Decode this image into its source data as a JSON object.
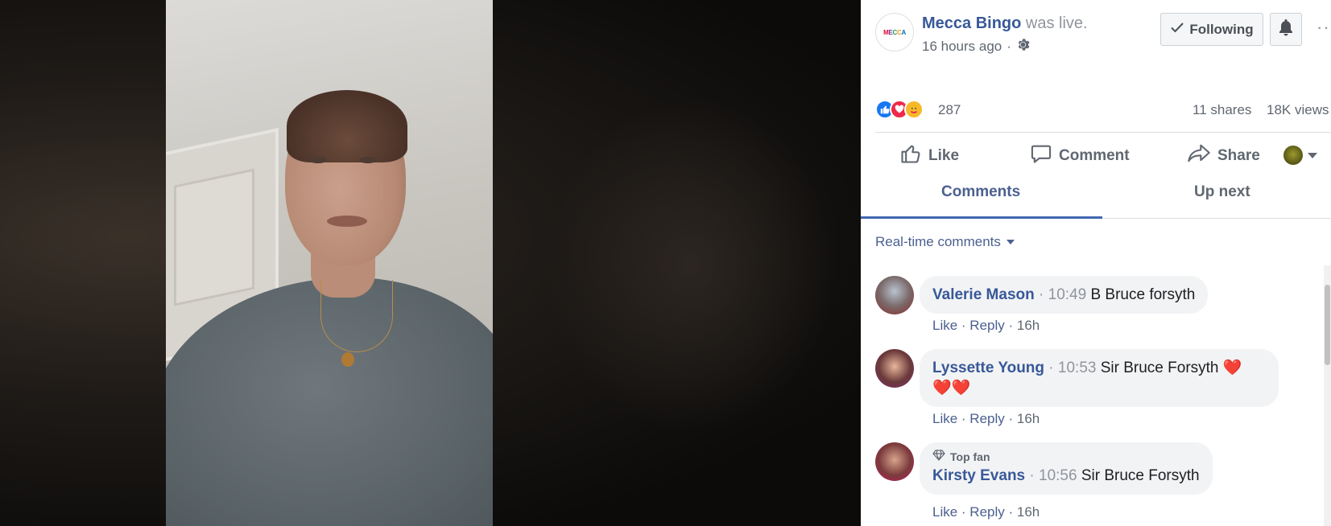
{
  "post": {
    "page_name": "Mecca Bingo",
    "status": "was live.",
    "time_ago": "16 hours ago",
    "separator": "·",
    "logo_text": [
      "M",
      "E",
      "C",
      "C",
      "A"
    ]
  },
  "header_buttons": {
    "following_label": "Following",
    "more_label": "···"
  },
  "stats": {
    "reaction_count": "287",
    "shares": "11 shares",
    "views": "18K views"
  },
  "actions": {
    "like": "Like",
    "comment": "Comment",
    "share": "Share"
  },
  "tabs": {
    "comments": "Comments",
    "up_next": "Up next"
  },
  "sort": {
    "label": "Real-time comments"
  },
  "comments": [
    {
      "name": "Valerie Mason",
      "time": "10:49",
      "text": "B Bruce forsyth",
      "like": "Like",
      "reply": "Reply",
      "age": "16h"
    },
    {
      "name": "Lyssette Young",
      "time": "10:53",
      "text": "Sir Bruce Forsyth",
      "hearts_line1": "❤️",
      "hearts_line2": "❤️❤️",
      "like": "Like",
      "reply": "Reply",
      "age": "16h"
    },
    {
      "badge": "Top fan",
      "name": "Kirsty Evans",
      "time": "10:56",
      "text": "Sir Bruce Forsyth",
      "like": "Like",
      "reply": "Reply",
      "age": "16h"
    }
  ],
  "colors": {
    "link_blue": "#385898",
    "tab_accent": "#4267b2",
    "muted_gray": "#90949c",
    "bubble_bg": "#f2f3f5"
  }
}
